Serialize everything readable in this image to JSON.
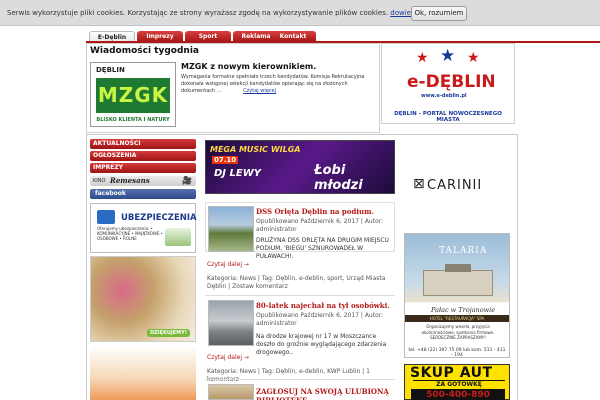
{
  "cookie": {
    "text": "Serwis wykorzystuje pliki cookies. Korzystając ze strony wyrażasz zgodę na wykorzystywanie plików cookies.",
    "link": "dowiedz się więcej.",
    "ok_button": "Ok, rozumiem"
  },
  "nav": {
    "tabs": [
      "E-Dęblin",
      "Imprezy",
      "Sport",
      "Reklama",
      "Kontakt"
    ],
    "active_tab": "E-Dęblin"
  },
  "news_week": {
    "heading": "Wiadomości tygodnia",
    "logo_top": "DĘBLIN",
    "logo_text": "MZGK",
    "logo_sub": "BLISKO KLIENTA I NATURY",
    "title": "MZGK z nowym kierownikiem.",
    "description": "Wymagania formalne spełniało trzech kandydatów. Komisja Rekrutacyjna dokonała wstępnej selekcji kandydatów opierając się na złożonych dokumentach ...",
    "read_more": "Czytaj więcej"
  },
  "site_logo": {
    "brand": "e-DĘBLIN",
    "url": "www.e-deblin.pl",
    "tagline": "DĘBLIN - PORTAL NOWOCZESNEGO MIASTA"
  },
  "sidebar": {
    "menu": [
      "AKTUALNOŚCI",
      "OGŁOSZENIA",
      "IMPREZY"
    ],
    "kino_label": "KINO",
    "kino_brand": "Remesans",
    "facebook": "facebook"
  },
  "ads": {
    "ubez_title": "UBEZPIECZENIA",
    "ubez_list": "Oferujemy ubezpieczenia: • KOMUNIKACYJNE • MAJĄTKOWE • OSOBOWE • ROLNE",
    "flowers_thanks": "DZIĘKUJEMY!",
    "banner_title": "MEGA MUSIC WILGA",
    "banner_date": "07.10",
    "banner_dj": "DJ LEWY",
    "banner_band": "Łobi młodzi",
    "carinii": "CARINII",
    "palace_brand": "TALARIA",
    "palace_name": "Pałac w Trojanowie",
    "palace_bar": "HOTEL \"RESTAURACJA\" SPA",
    "palace_info": "Organizujemy wesela, przyjęcia okolicznościowe, spotkania firmowe. SERDECZNIE ZAPRASZAMY!",
    "palace_phone": "tel. +48 (22) 397 75 09 lub kom. 511 - 411 - 194",
    "skup_title": "SKUP AUT",
    "skup_sub": "ZA GOTÓWKĘ",
    "skup_phone": "500-400-890"
  },
  "posts": [
    {
      "title": "DSS Orlęta Dęblin na podium.",
      "meta": "Opublikowano Październik 6, 2017 | Autor: administrator",
      "body": "DRUŻYNA DSS ORLĘTA NA DRUGIM MIEJSCU PODIUM, 'BIEGU' SZNUROWADEŁ W PUŁAWACH!.",
      "read_more": "Czytaj dalej →",
      "cats": "Kategoria: News | Tag: Dęblin, e-deblin, sport, Urząd Miasta Dęblin | Zostaw komentarz"
    },
    {
      "title": "80-latek najechał na tył osobówki.",
      "meta": "Opublikowano Październik 6, 2017 | Autor: administrator",
      "body": "Na drodze krajowej nr 17 w Moszczance doszło do groźnie wyglądającego zdarzenia drogowego..",
      "read_more": "Czytaj dalej →",
      "cats": "Kategoria: News | Tag: Dęblin, e-deblin, KWP Lublin | 1 komentarz"
    },
    {
      "title": "ZAGŁOSUJ NA SWOJĄ ULUBIONĄ BIBLIOTEKĘ"
    }
  ]
}
